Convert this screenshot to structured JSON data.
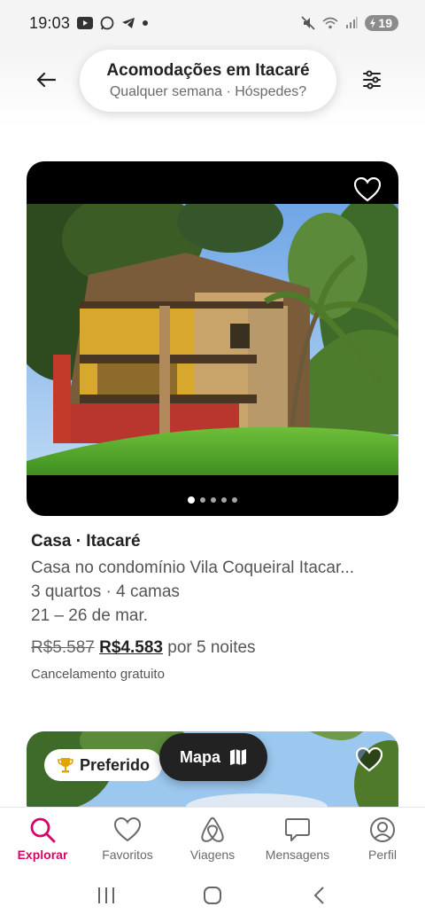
{
  "status_bar": {
    "time": "19:03",
    "battery": "19"
  },
  "header": {
    "title": "Acomodações em Itacaré",
    "subtitle": "Qualquer semana · Hóspedes?"
  },
  "listing": {
    "title": "Casa · Itacaré",
    "name": "Casa no condomínio Vila Coqueiral Itacar...",
    "rooms": "3 quartos · 4 camas",
    "dates": "21 – 26 de mar.",
    "old_price": "R$5.587",
    "new_price": "R$4.583",
    "price_suffix": "por 5 noites",
    "cancellation": "Cancelamento gratuito",
    "photo_count": 5,
    "active_photo": 1
  },
  "listing2": {
    "badge": "Preferido"
  },
  "map_button": {
    "label": "Mapa"
  },
  "bottom_nav": {
    "items": [
      {
        "label": "Explorar",
        "icon": "search-icon",
        "active": true
      },
      {
        "label": "Favoritos",
        "icon": "heart-icon",
        "active": false
      },
      {
        "label": "Viagens",
        "icon": "airbnb-logo-icon",
        "active": false
      },
      {
        "label": "Mensagens",
        "icon": "message-icon",
        "active": false
      },
      {
        "label": "Perfil",
        "icon": "profile-icon",
        "active": false
      }
    ]
  },
  "colors": {
    "accent": "#d70466",
    "text_primary": "#222222",
    "text_secondary": "#555555"
  }
}
